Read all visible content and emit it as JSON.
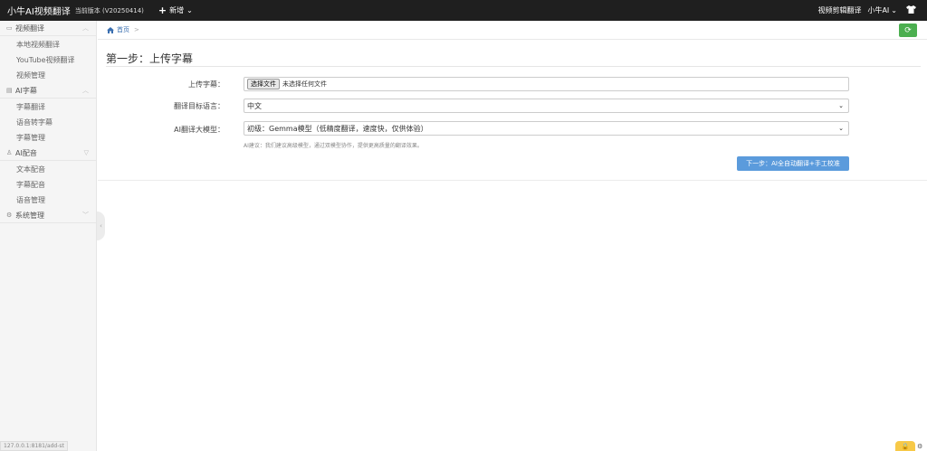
{
  "topbar": {
    "brand": "小牛AI视频翻译",
    "version": "当前版本 (V20250414)",
    "add_label": "新增",
    "menu_right": "视频剪辑翻译",
    "user": "小牛AI"
  },
  "sidebar": {
    "groups": [
      {
        "label": "视频翻译",
        "items": [
          "本地视频翻译",
          "YouTube视频翻译",
          "视频管理"
        ]
      },
      {
        "label": "AI字幕",
        "items": [
          "字幕翻译",
          "语音转字幕",
          "字幕管理"
        ]
      },
      {
        "label": "AI配音",
        "items": [
          "文本配音",
          "字幕配音",
          "语音管理"
        ]
      },
      {
        "label": "系统管理",
        "items": []
      }
    ],
    "status_url": "127.0.0.1:8181/add-st"
  },
  "breadcrumb": {
    "home": "首页",
    "sep": ">"
  },
  "page": {
    "title": "第一步：上传字幕",
    "upload_label": "上传字幕：",
    "file_button": "选择文件",
    "file_status": "未选择任何文件",
    "target_lang_label": "翻译目标语言：",
    "target_lang_value": "中文",
    "model_label": "AI翻译大模型：",
    "model_value": "初级：Gemma模型（低精度翻译，速度快，仅供体验）",
    "hint": "AI建议：我们建议高级模型，通过双模型协作，提供更高质量的翻译效果。",
    "next_button": "下一步：AI全自动翻译+手工校准"
  },
  "colors": {
    "topbar": "#1f1f1f",
    "refresh_button": "#4caf50",
    "next_button": "#5b9bdc",
    "link": "#3a6fb0"
  }
}
